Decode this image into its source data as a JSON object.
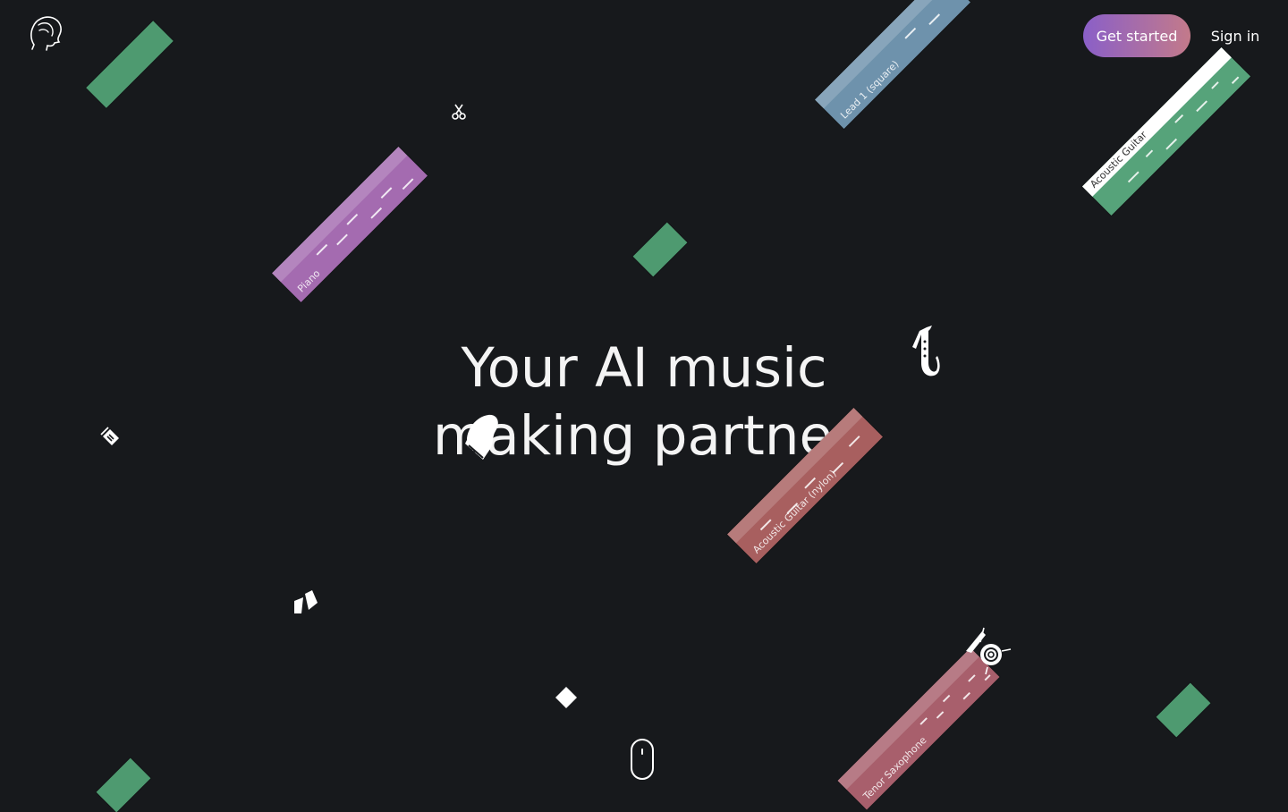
{
  "header": {
    "get_started_label": "Get started",
    "sign_in_label": "Sign in"
  },
  "hero": {
    "line1": "Your AI music",
    "line2": "making partner"
  },
  "tracks": [
    {
      "name": "Lead 1 (square)",
      "color": "#6e92ac"
    },
    {
      "name": "Acoustic Guitar",
      "color": "#56a37a"
    },
    {
      "name": "Piano",
      "color": "#a46bb0"
    },
    {
      "name": "Acoustic Guitar (nylon)",
      "color": "#a85f5f"
    },
    {
      "name": "Tenor Saxophone",
      "color": "#a85f6c"
    }
  ],
  "colors": {
    "background": "#17191c",
    "accent_gradient_start": "#8a5fc8",
    "accent_gradient_end": "#c37a8a",
    "block_green": "#4e9a70"
  },
  "icons": [
    "profile-head-logo-icon",
    "scissors-icon",
    "saxophone-icon",
    "grand-piano-icon",
    "metronome-icon",
    "maracas-icon",
    "diamond-icon",
    "drum-kit-icon",
    "scroll-mouse-icon"
  ]
}
